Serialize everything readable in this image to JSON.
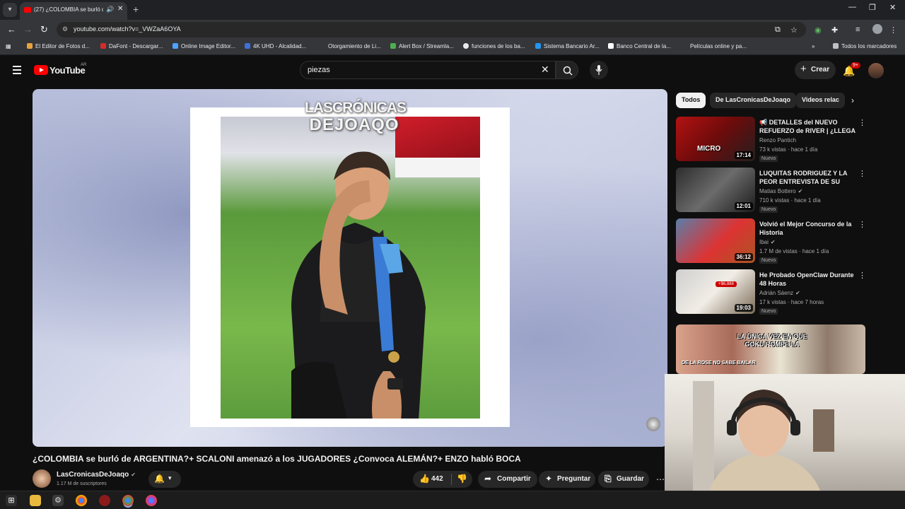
{
  "browser": {
    "tab_title": "(27) ¿COLOMBIA se burló d",
    "url": "youtube.com/watch?v=_VWZaA6OYA",
    "bookmarks": [
      "El Editor de Fotos d...",
      "DaFont - Descargar...",
      "Online Image Editor...",
      "4K UHD - Alcalidad...",
      "Otorgamiento de Li...",
      "Alert Box / Streamla...",
      "funciones de los ba...",
      "Sistema Bancario Ar...",
      "Banco Central de la...",
      "Películas online y pa..."
    ],
    "all_bookmarks": "Todos los marcadores"
  },
  "youtube": {
    "wordmark": "YouTube",
    "region": "AR",
    "search_query": "piezas",
    "create_label": "Crear",
    "notification_count": "9+"
  },
  "player": {
    "logo_line1": "LASCRÓNICAS",
    "logo_line2": "DEJOAQO"
  },
  "video": {
    "title": "¿COLOMBIA se burló de ARGENTINA?+ SCALONI amenazó a los JUGADORES ¿Convoca ALEMÁN?+ ENZO habló BOCA",
    "channel": "LasCronicasDeJoaqo",
    "subscribers": "1.17 M de suscriptores",
    "likes": "442",
    "share_label": "Compartir",
    "ask_label": "Preguntar",
    "save_label": "Guardar"
  },
  "sidebar": {
    "chips": [
      "Todos",
      "De LasCronicasDeJoaqo",
      "Videos relac"
    ],
    "recommendations": [
      {
        "title": "📢 DETALLES del NUEVO REFUERZO de RIVER | ¿LLEGA ...",
        "channel": "Renzo Pantich",
        "stats": "73 k vistas · hace 1 día",
        "badge": "Nuevo",
        "duration": "17:14",
        "thumb_text": "MICRO"
      },
      {
        "title": "LUQUITAS RODRIGUEZ Y LA PEOR ENTREVISTA DE SU VID...",
        "channel": "Matias Bottero",
        "stats": "710 k vistas · hace 1 día",
        "badge": "Nuevo",
        "duration": "12:01",
        "thumb_text": ""
      },
      {
        "title": "Volvió el Mejor Concurso de la Historia",
        "channel": "Ibai",
        "stats": "1.7 M de vistas · hace 1 día",
        "badge": "Nuevo",
        "duration": "36:12",
        "thumb_text": ""
      },
      {
        "title": "He Probado OpenClaw Durante 48 Horas",
        "channel": "Adrián Sáenz",
        "stats": "17 k vistas · hace 7 horas",
        "badge": "Nuevo",
        "duration": "19:03",
        "thumb_text": "+$6,888"
      }
    ],
    "short": {
      "caption_top": "LA ÚNICA VEZ EN QUE GOKU ROMPE LA",
      "caption_bottom": "DE LA ROSE NO SABE BAILAR"
    }
  }
}
